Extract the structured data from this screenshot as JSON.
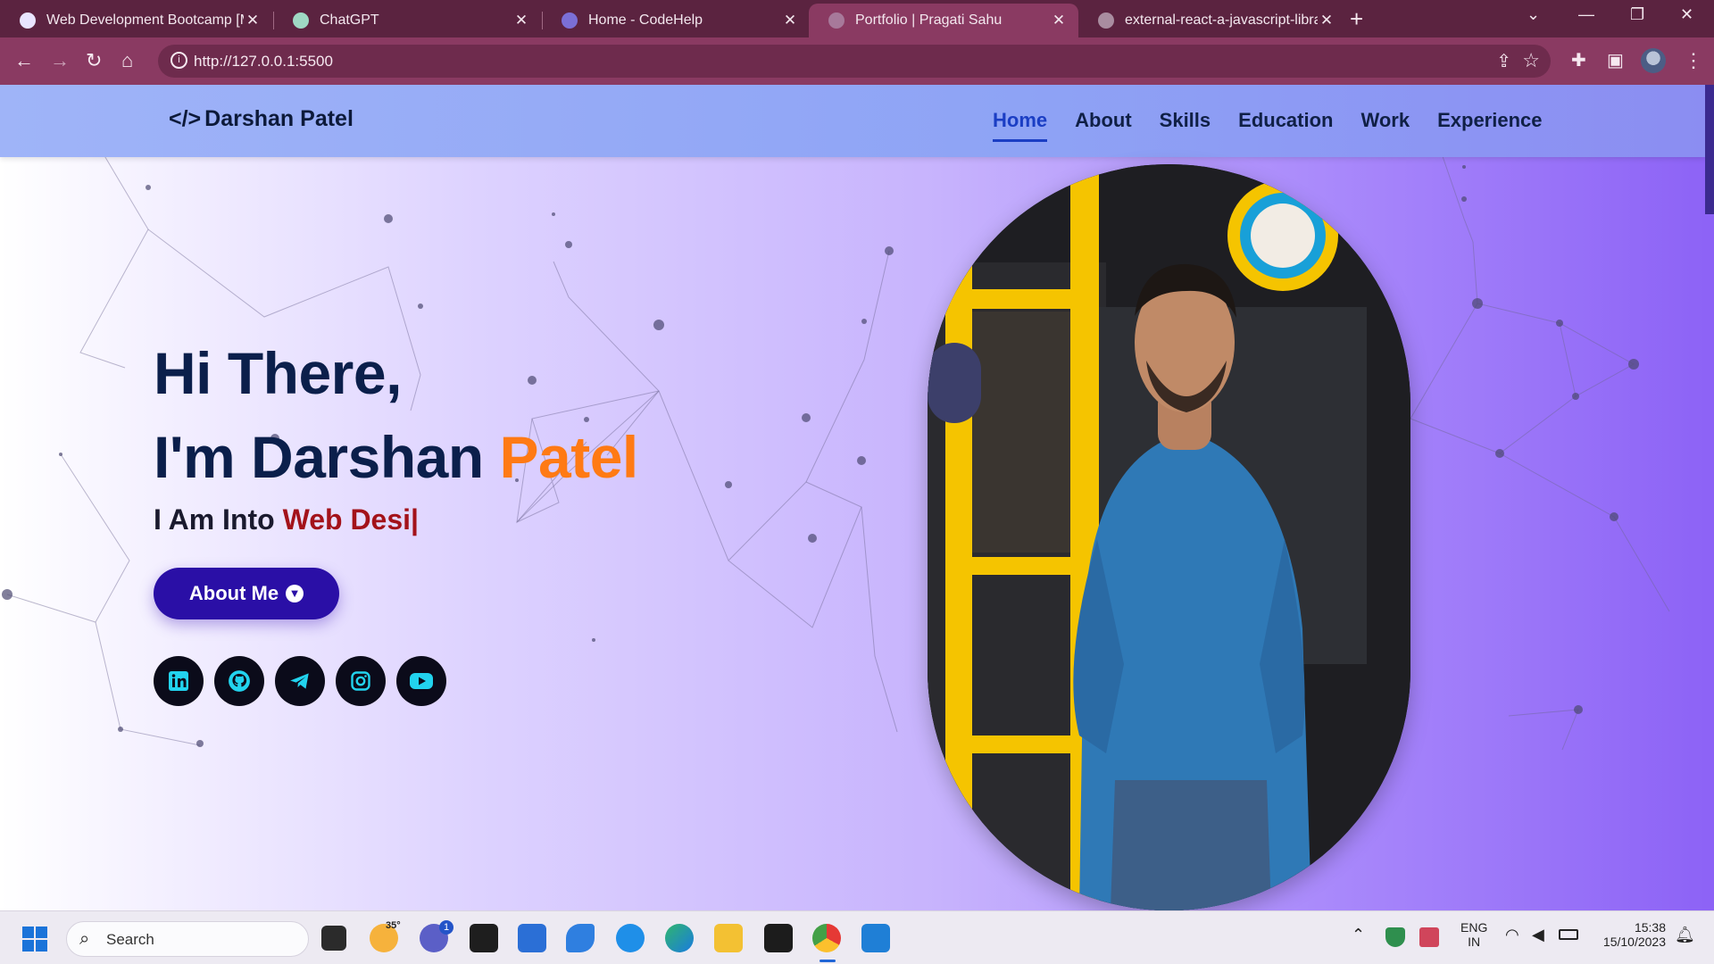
{
  "browser": {
    "tabs": [
      {
        "title": "Web Development Bootcamp [M",
        "active": false
      },
      {
        "title": "ChatGPT",
        "active": false
      },
      {
        "title": "Home - CodeHelp",
        "active": false
      },
      {
        "title": "Portfolio | Pragati Sahu",
        "active": true
      },
      {
        "title": "external-react-a-javascript-librar",
        "active": false
      }
    ],
    "url": "http://127.0.0.1:5500"
  },
  "site": {
    "brand": "Darshan Patel",
    "brand_code": "</>",
    "nav": [
      "Home",
      "About",
      "Skills",
      "Education",
      "Work",
      "Experience"
    ],
    "active_nav": "Home",
    "hero": {
      "line1": "Hi There,",
      "line2_prefix": "I'm Darshan ",
      "line2_accent": "Patel",
      "typed_prefix": "I Am Into ",
      "typed_text": "Web Desi|",
      "button_label": "About Me"
    },
    "socials": [
      "linkedin-icon",
      "github-icon",
      "telegram-icon",
      "instagram-icon",
      "youtube-icon"
    ],
    "colors": {
      "accent": "#ff7a14",
      "navy": "#0b1f4b",
      "button": "#2a0fa6",
      "typed": "#a3121a"
    }
  },
  "taskbar": {
    "search_label": "Search",
    "weather": "35°",
    "badge": "1",
    "lang_top": "ENG",
    "lang_bottom": "IN",
    "time": "15:38",
    "date": "15/10/2023"
  }
}
